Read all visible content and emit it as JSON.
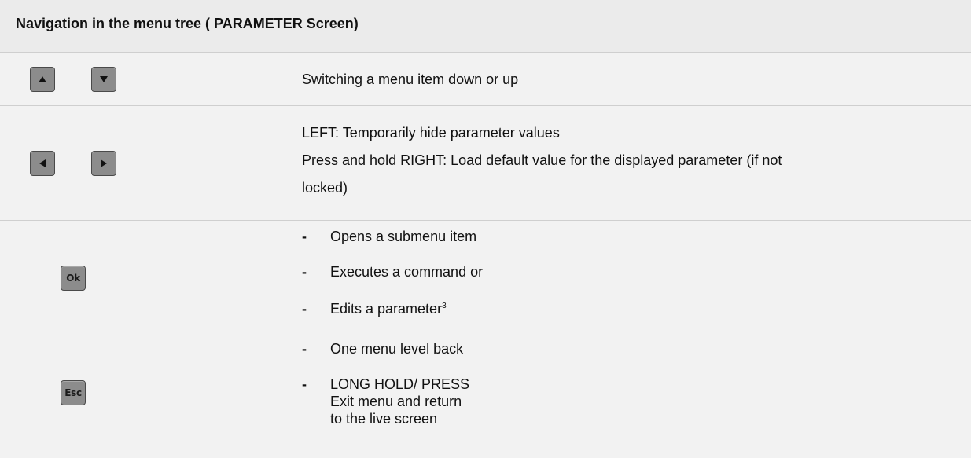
{
  "header": {
    "title": "Navigation in the menu tree ( PARAMETER Screen)"
  },
  "rows": [
    {
      "keys": [
        {
          "name": "up-arrow-key",
          "icon": "triangle-up-icon"
        },
        {
          "name": "down-arrow-key",
          "icon": "triangle-down-icon"
        }
      ],
      "description": "Switching a menu item down or up"
    },
    {
      "keys": [
        {
          "name": "left-arrow-key",
          "icon": "triangle-left-icon"
        },
        {
          "name": "right-arrow-key",
          "icon": "triangle-right-icon"
        }
      ],
      "lines": [
        "LEFT: Temporarily hide parameter values",
        "Press and hold RIGHT: Load default value for the displayed parameter (if not",
        "locked)"
      ]
    },
    {
      "key_label": "Ok",
      "bullets": [
        {
          "dash": "-",
          "text": "Opens a submenu item"
        },
        {
          "dash": "-",
          "text": "Executes a command or"
        },
        {
          "dash": "-",
          "text": "Edits a parameter",
          "superscript": "3"
        }
      ]
    },
    {
      "key_label": "Esc",
      "bullets": [
        {
          "dash": "-",
          "text": "One menu level back"
        },
        {
          "dash": "-",
          "text": "LONG HOLD/ PRESS",
          "extra_lines": [
            "Exit menu and return",
            "to the live screen"
          ]
        }
      ]
    }
  ],
  "colors": {
    "key_fill": "#8c8c8c",
    "key_border": "#4a4a4a",
    "row_background": "#f2f2f2",
    "header_background": "#ebebeb",
    "separator": "#cfcfcf"
  }
}
